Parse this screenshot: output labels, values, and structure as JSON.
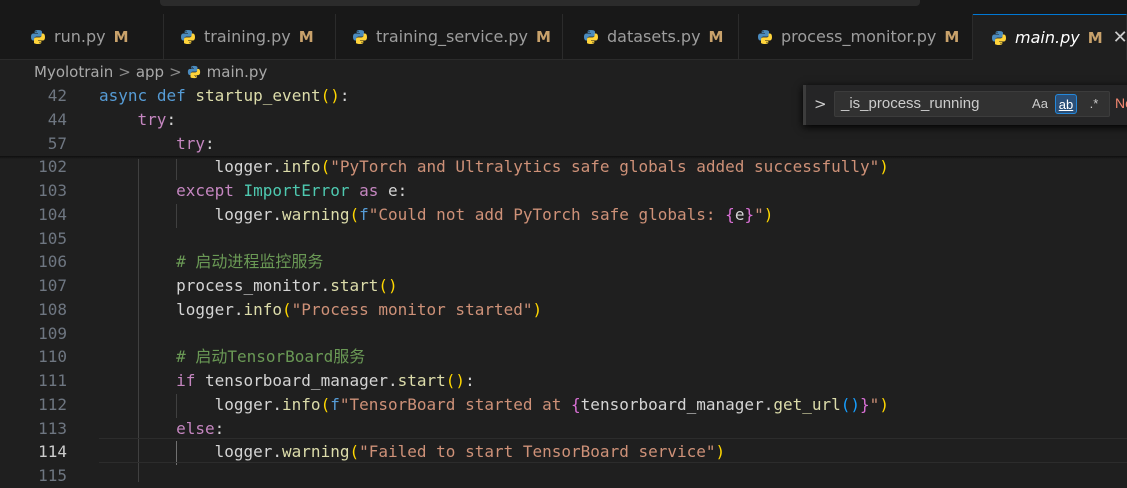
{
  "tabs": [
    {
      "name": "run.py",
      "status": "M",
      "active": false
    },
    {
      "name": "training.py",
      "status": "M",
      "active": false
    },
    {
      "name": "training_service.py",
      "status": "M",
      "active": false
    },
    {
      "name": "datasets.py",
      "status": "M",
      "active": false
    },
    {
      "name": "process_monitor.py",
      "status": "M",
      "active": false
    },
    {
      "name": "main.py",
      "status": "M",
      "active": true
    }
  ],
  "close_glyph": "✕",
  "breadcrumb": {
    "root": "Myolotrain",
    "folder": "app",
    "file": "main.py",
    "sep": ">"
  },
  "find_widget": {
    "expand_glyph": ">",
    "query": "_is_process_running",
    "match_case": "Aa",
    "whole_word": "ab",
    "regex": ".*",
    "result": "No"
  },
  "lines": [
    {
      "num": "42",
      "text": "async def startup_event():"
    },
    {
      "num": "44",
      "text": "    try:"
    },
    {
      "num": "57",
      "text": "        try:"
    },
    {
      "num": "102",
      "text": "            logger.info(\"PyTorch and Ultralytics safe globals added successfully\")"
    },
    {
      "num": "103",
      "text": "        except ImportError as e:"
    },
    {
      "num": "104",
      "text": "            logger.warning(f\"Could not add PyTorch safe globals: {e}\")"
    },
    {
      "num": "105",
      "text": ""
    },
    {
      "num": "106",
      "text": "        # 启动进程监控服务"
    },
    {
      "num": "107",
      "text": "        process_monitor.start()"
    },
    {
      "num": "108",
      "text": "        logger.info(\"Process monitor started\")"
    },
    {
      "num": "109",
      "text": ""
    },
    {
      "num": "110",
      "text": "        # 启动TensorBoard服务"
    },
    {
      "num": "111",
      "text": "        if tensorboard_manager.start():"
    },
    {
      "num": "112",
      "text": "            logger.info(f\"TensorBoard started at {tensorboard_manager.get_url()}\")"
    },
    {
      "num": "113",
      "text": "        else:"
    },
    {
      "num": "114",
      "text": "            logger.warning(\"Failed to start TensorBoard service\")"
    },
    {
      "num": "115",
      "text": ""
    }
  ],
  "colors": {
    "background": "#1f1f1f",
    "keyword": "#569cd6",
    "control": "#c586c0",
    "function": "#dcdcaa",
    "string": "#ce9178",
    "comment": "#6a9955",
    "class": "#4ec9b0",
    "modified": "#c9a26b",
    "active_tab_border": "#0078d4"
  }
}
